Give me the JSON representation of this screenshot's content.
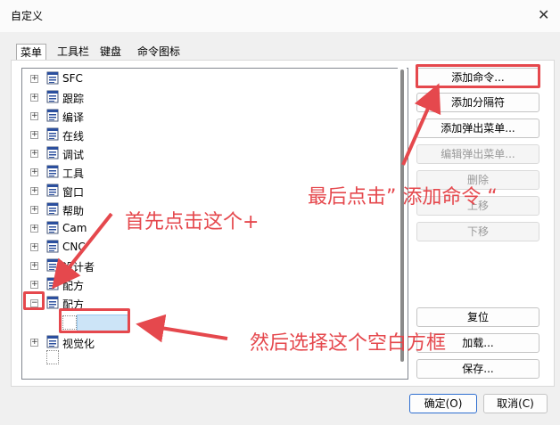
{
  "window": {
    "title": "自定义",
    "close_icon": "close-icon"
  },
  "tabs": [
    {
      "label": "菜单",
      "active": true
    },
    {
      "label": "工具栏",
      "active": false
    },
    {
      "label": "键盘",
      "active": false
    },
    {
      "label": "命令图标",
      "active": false
    }
  ],
  "tree": {
    "items": [
      {
        "label": "SFC",
        "expander": "+"
      },
      {
        "label": "跟踪",
        "expander": "+"
      },
      {
        "label": "编译",
        "expander": "+"
      },
      {
        "label": "在线",
        "expander": "+"
      },
      {
        "label": "调试",
        "expander": "+"
      },
      {
        "label": "工具",
        "expander": "+"
      },
      {
        "label": "窗口",
        "expander": "+"
      },
      {
        "label": "帮助",
        "expander": "+"
      },
      {
        "label": "Cam",
        "expander": "+"
      },
      {
        "label": "CNC",
        "expander": "+"
      },
      {
        "label": "设计者",
        "expander": "+"
      },
      {
        "label": "配方",
        "expander": "+"
      },
      {
        "label": "配方",
        "expander": "−"
      },
      {
        "label": "",
        "expander": ""
      },
      {
        "label": "视觉化",
        "expander": "+"
      }
    ]
  },
  "buttons": {
    "add_command": "添加命令...",
    "add_separator": "添加分隔符",
    "add_popup_menu": "添加弹出菜单...",
    "edit_popup_menu": "编辑弹出菜单...",
    "delete": "删除",
    "move_up": "上移",
    "move_down": "下移",
    "reset": "复位",
    "load": "加载...",
    "save": "保存...",
    "ok": "确定(O)",
    "cancel": "取消(C)"
  },
  "annotations": {
    "step1": "首先点击这个+",
    "step2": "然后选择这个空白方框",
    "step3": "最后点击” 添加命令 “"
  },
  "colors": {
    "annotation_red": "#e5484d",
    "selection_blue": "#cce4f7"
  }
}
